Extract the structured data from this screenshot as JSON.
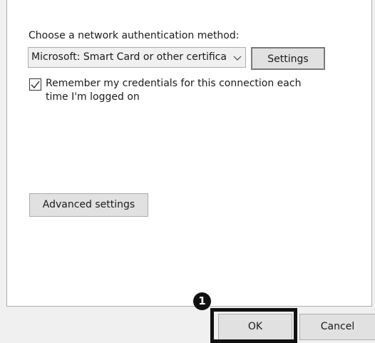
{
  "auth": {
    "method_label": "Choose a network authentication method:",
    "selected_method": "Microsoft: Smart Card or other certifica",
    "settings_label": "Settings"
  },
  "remember": {
    "checked": true,
    "label": "Remember my credentials for this connection each time I'm logged on"
  },
  "advanced": {
    "label": "Advanced settings"
  },
  "footer": {
    "ok_label": "OK",
    "cancel_label": "Cancel"
  },
  "annotation": {
    "callout_number": "1"
  }
}
